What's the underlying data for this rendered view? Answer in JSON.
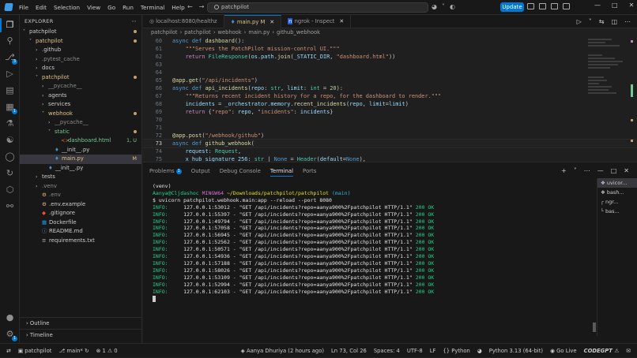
{
  "titlebar": {
    "menus": [
      "File",
      "Edit",
      "Selection",
      "View",
      "Go",
      "Run",
      "Terminal",
      "Help"
    ],
    "search_text": "patchpilot",
    "update_label": "Update"
  },
  "sidebar": {
    "title": "Explorer",
    "tree": [
      {
        "label": "patchpilot",
        "indent": 0,
        "type": "folder-open",
        "state": "",
        "mark": "dot"
      },
      {
        "label": "patchpilot",
        "indent": 1,
        "type": "folder-open",
        "state": "mod",
        "mark": "dot"
      },
      {
        "label": ".github",
        "indent": 2,
        "type": "folder",
        "state": "",
        "mark": ""
      },
      {
        "label": ".pytest_cache",
        "indent": 2,
        "type": "folder",
        "state": "dim",
        "mark": ""
      },
      {
        "label": "docs",
        "indent": 2,
        "type": "folder",
        "state": "",
        "mark": ""
      },
      {
        "label": "patchpilot",
        "indent": 2,
        "type": "folder-open",
        "state": "mod",
        "mark": "dot"
      },
      {
        "label": "__pycache__",
        "indent": 3,
        "type": "folder",
        "state": "dim",
        "mark": ""
      },
      {
        "label": "agents",
        "indent": 3,
        "type": "folder",
        "state": "",
        "mark": ""
      },
      {
        "label": "services",
        "indent": 3,
        "type": "folder",
        "state": "",
        "mark": ""
      },
      {
        "label": "webhook",
        "indent": 3,
        "type": "folder-open",
        "state": "mod",
        "mark": "dot"
      },
      {
        "label": "__pycache__",
        "indent": 4,
        "type": "folder",
        "state": "dim",
        "mark": ""
      },
      {
        "label": "static",
        "indent": 4,
        "type": "folder-open",
        "state": "unt",
        "mark": "dot"
      },
      {
        "label": "dashboard.html",
        "indent": 5,
        "type": "html",
        "state": "unt",
        "mark": "1, U"
      },
      {
        "label": "__init__.py",
        "indent": 4,
        "type": "py",
        "state": "",
        "mark": ""
      },
      {
        "label": "main.py",
        "indent": 4,
        "type": "py",
        "state": "mod",
        "mark": "M",
        "selected": true
      },
      {
        "label": "__init__.py",
        "indent": 3,
        "type": "py",
        "state": "",
        "mark": ""
      },
      {
        "label": "tests",
        "indent": 2,
        "type": "folder",
        "state": "",
        "mark": ""
      },
      {
        "label": ".venv",
        "indent": 2,
        "type": "folder",
        "state": "dim",
        "mark": ""
      },
      {
        "label": ".env",
        "indent": 2,
        "type": "env",
        "state": "dim",
        "mark": ""
      },
      {
        "label": ".env.example",
        "indent": 2,
        "type": "env",
        "state": "",
        "mark": ""
      },
      {
        "label": ".gitignore",
        "indent": 2,
        "type": "git",
        "state": "",
        "mark": ""
      },
      {
        "label": "Dockerfile",
        "indent": 2,
        "type": "docker",
        "state": "",
        "mark": ""
      },
      {
        "label": "README.md",
        "indent": 2,
        "type": "md",
        "state": "",
        "mark": ""
      },
      {
        "label": "requirements.txt",
        "indent": 2,
        "type": "txt",
        "state": "",
        "mark": ""
      }
    ],
    "outline_label": "Outline",
    "timeline_label": "Timeline"
  },
  "tabs": [
    {
      "label": "localhost:8080/healthz",
      "active": false,
      "icon": "globe-icon"
    },
    {
      "label": "main.py",
      "suffix": "M",
      "active": true,
      "icon": "python-icon"
    },
    {
      "label": "ngrok - Inspect",
      "active": false,
      "icon": "ngrok-icon"
    }
  ],
  "breadcrumb": [
    "patchpilot",
    "patchpilot",
    "webhook",
    "main.py",
    "github_webhook"
  ],
  "editor": {
    "current_line": 73,
    "lines": [
      {
        "n": 60,
        "html": "<span class='k'>async</span> <span class='k'>def</span> <span class='f'>dashboard</span><span class='p'>():</span>"
      },
      {
        "n": 61,
        "html": "    <span class='s'>\"\"\"Serves the PatchPilot mission-control UI.\"\"\"</span>"
      },
      {
        "n": 62,
        "html": "    <span class='kc'>return</span> <span class='t'>FileResponse</span><span class='p'>(</span><span class='v'>os</span><span class='p'>.</span><span class='v'>path</span><span class='p'>.</span><span class='f'>join</span><span class='p'>(</span><span class='v'>_STATIC_DIR</span><span class='p'>, </span><span class='s'>\"dashboard.html\"</span><span class='p'>))</span>"
      },
      {
        "n": 63,
        "html": ""
      },
      {
        "n": 64,
        "html": ""
      },
      {
        "n": 65,
        "html": "<span class='d'>@app.get</span><span class='p'>(</span><span class='s'>\"/api/incidents\"</span><span class='p'>)</span>"
      },
      {
        "n": 66,
        "html": "<span class='k'>async</span> <span class='k'>def</span> <span class='f'>api_incidents</span><span class='p'>(</span><span class='v'>repo</span><span class='p'>: </span><span class='t'>str</span><span class='p'>, </span><span class='v'>limit</span><span class='p'>: </span><span class='t'>int</span> <span class='p'>= </span><span class='n'>20</span><span class='p'>):</span>"
      },
      {
        "n": 67,
        "html": "    <span class='s'>\"\"\"Returns recent incident history for a repo, for the dashboard to render.\"\"\"</span>"
      },
      {
        "n": 68,
        "html": "    <span class='v'>incidents</span> <span class='p'>= </span><span class='v'>_orchestrator</span><span class='p'>.</span><span class='v'>memory</span><span class='p'>.</span><span class='f'>recent_incidents</span><span class='p'>(</span><span class='v'>repo</span><span class='p'>, </span><span class='v'>limit</span><span class='p'>=</span><span class='v'>limit</span><span class='p'>)</span>"
      },
      {
        "n": 69,
        "html": "    <span class='kc'>return</span> <span class='p'>{</span><span class='s'>\"repo\"</span><span class='p'>: </span><span class='v'>repo</span><span class='p'>, </span><span class='s'>\"incidents\"</span><span class='p'>: </span><span class='v'>incidents</span><span class='p'>}</span>"
      },
      {
        "n": 70,
        "html": ""
      },
      {
        "n": 71,
        "html": ""
      },
      {
        "n": 72,
        "html": "<span class='d'>@app.post</span><span class='p'>(</span><span class='s'>\"/webhook/github\"</span><span class='p'>)</span>"
      },
      {
        "n": 73,
        "html": "<span class='k'>async</span> <span class='k'>def</span> <span class='f'>github_webhook</span><span class='p'>(</span>"
      },
      {
        "n": 74,
        "html": "    <span class='v'>request</span><span class='p'>: </span><span class='t'>Request</span><span class='p'>,</span>"
      },
      {
        "n": 75,
        "html": "    <span class='v'>x_hub_signature_256</span><span class='p'>: </span><span class='t'>str</span> <span class='p'>| </span><span class='k'>None</span> <span class='p'>= </span><span class='t'>Header</span><span class='p'>(</span><span class='v'>default</span><span class='p'>=</span><span class='k'>None</span><span class='p'>),</span>"
      }
    ]
  },
  "panel": {
    "tabs": [
      "Problems",
      "Output",
      "Debug Console",
      "Terminal",
      "Ports"
    ],
    "problems_count": "1",
    "active_tab": "Terminal",
    "terminal": {
      "venv": "(venv)",
      "prompt_user": "Aanya@Cljdashoc",
      "prompt_env": "MINGW64",
      "prompt_path": "~/Downloads/patchpilot/patchpilot",
      "prompt_branch": "(main)",
      "command": "$ uvicorn patchpilot.webhook.main:app --reload --port 8080",
      "logs": [
        {
          "level": "INFO:",
          "addr": "127.0.0.1:53012",
          "req": "\"GET /api/incidents?repo=aanya900%2Fpatchpilot HTTP/1.1\"",
          "status": "200 OK"
        },
        {
          "level": "INFO:",
          "addr": "127.0.0.1:55397",
          "req": "\"GET /api/incidents?repo=aanya900%2Fpatchpilot HTTP/1.1\"",
          "status": "200 OK"
        },
        {
          "level": "INFO:",
          "addr": "127.0.0.1:49794",
          "req": "\"GET /api/incidents?repo=aanya900%2Fpatchpilot HTTP/1.1\"",
          "status": "200 OK"
        },
        {
          "level": "INFO:",
          "addr": "127.0.0.1:57058",
          "req": "\"GET /api/incidents?repo=aanya900%2Fpatchpilot HTTP/1.1\"",
          "status": "200 OK"
        },
        {
          "level": "INFO:",
          "addr": "127.0.0.1:56945",
          "req": "\"GET /api/incidents?repo=aanya900%2Fpatchpilot HTTP/1.1\"",
          "status": "200 OK"
        },
        {
          "level": "INFO:",
          "addr": "127.0.0.1:52562",
          "req": "\"GET /api/incidents?repo=aanya900%2Fpatchpilot HTTP/1.1\"",
          "status": "200 OK"
        },
        {
          "level": "INFO:",
          "addr": "127.0.0.1:50571",
          "req": "\"GET /api/incidents?repo=aanya900%2Fpatchpilot HTTP/1.1\"",
          "status": "200 OK"
        },
        {
          "level": "INFO:",
          "addr": "127.0.0.1:54936",
          "req": "\"GET /api/incidents?repo=aanya900%2Fpatchpilot HTTP/1.1\"",
          "status": "200 OK"
        },
        {
          "level": "INFO:",
          "addr": "127.0.0.1:57188",
          "req": "\"GET /api/incidents?repo=aanya900%2Fpatchpilot HTTP/1.1\"",
          "status": "200 OK"
        },
        {
          "level": "INFO:",
          "addr": "127.0.0.1:58026",
          "req": "\"GET /api/incidents?repo=aanya900%2Fpatchpilot HTTP/1.1\"",
          "status": "200 OK"
        },
        {
          "level": "INFO:",
          "addr": "127.0.0.1:53109",
          "req": "\"GET /api/incidents?repo=aanya900%2Fpatchpilot HTTP/1.1\"",
          "status": "200 OK"
        },
        {
          "level": "INFO:",
          "addr": "127.0.0.1:52994",
          "req": "\"GET /api/incidents?repo=aanya900%2Fpatchpilot HTTP/1.1\"",
          "status": "200 OK"
        },
        {
          "level": "INFO:",
          "addr": "127.0.0.1:62103",
          "req": "\"GET /api/incidents?repo=aanya900%2Fpatchpilot HTTP/1.1\"",
          "status": "200 OK"
        }
      ]
    },
    "terminal_list": [
      "uvicor...",
      "bash...",
      "ngr...",
      "bas..."
    ]
  },
  "statusbar": {
    "branch_repo": "patchpilot",
    "branch": "main*",
    "errors": "1",
    "warnings": "0",
    "blame": "Aanya Dhuriya (2 hours ago)",
    "position": "Ln 73, Col 26",
    "spaces": "Spaces: 4",
    "encoding": "UTF-8",
    "eol": "LF",
    "language": "Python",
    "interpreter": "Python 3.13 (64-bit)",
    "golive": "Go Live",
    "codegpt": "CODEGPT"
  },
  "colors": {
    "accent": "#0078d4",
    "modified": "#e2c08d",
    "untracked": "#73c991"
  }
}
